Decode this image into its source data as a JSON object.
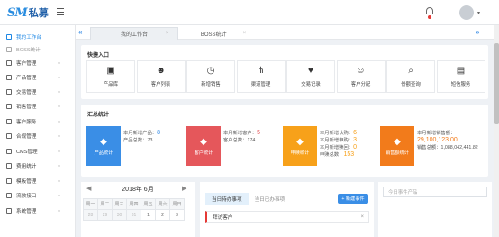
{
  "brand": {
    "mark": "SM",
    "name": "私募"
  },
  "sidebar": {
    "items": [
      {
        "label": "我的工作台",
        "active": true
      },
      {
        "label": "BOSS统计",
        "sub": true
      },
      {
        "label": "客户管理"
      },
      {
        "label": "产品管理"
      },
      {
        "label": "交易管理"
      },
      {
        "label": "销售管理"
      },
      {
        "label": "客户服务"
      },
      {
        "label": "合规管理"
      },
      {
        "label": "CMS管理"
      },
      {
        "label": "费用统计"
      },
      {
        "label": "模板管理"
      },
      {
        "label": "流数接口"
      },
      {
        "label": "系统管理"
      }
    ]
  },
  "tabs": {
    "left_arrow": "«",
    "right_arrow": "»",
    "items": [
      {
        "label": "我的工作台",
        "close": "×"
      },
      {
        "label": "BOSS统计",
        "close": "×"
      }
    ]
  },
  "quick": {
    "title": "快捷入口",
    "items": [
      {
        "label": "产品库",
        "icon": "box-icon"
      },
      {
        "label": "客户列表",
        "icon": "users-icon"
      },
      {
        "label": "新增销售",
        "icon": "clock-icon"
      },
      {
        "label": "渠道管理",
        "icon": "share-icon"
      },
      {
        "label": "交易记录",
        "icon": "handshake-icon"
      },
      {
        "label": "客户分配",
        "icon": "user-assign-icon"
      },
      {
        "label": "份额查询",
        "icon": "search-icon"
      },
      {
        "label": "短信服务",
        "icon": "clipboard-icon"
      }
    ]
  },
  "stats": {
    "title": "汇总统计",
    "cards": [
      {
        "box_label": "产品统计",
        "color": "#3a8ee6",
        "lines": [
          {
            "label": "本月新增产品：",
            "value": "8"
          },
          {
            "label": "产品总数：",
            "value": "73"
          }
        ]
      },
      {
        "box_label": "客户统计",
        "color": "#e5575b",
        "lines": [
          {
            "label": "本月新增客户：",
            "value": "5"
          },
          {
            "label": "客户总数：",
            "value": "174"
          }
        ]
      },
      {
        "box_label": "申赎统计",
        "color": "#f7a11a",
        "lines": [
          {
            "label": "本月新增认购：",
            "value": "6"
          },
          {
            "label": "本月新增申购：",
            "value": "3"
          },
          {
            "label": "本月新增赎回：",
            "value": "0"
          },
          {
            "label": "申赎总数：",
            "value": "153"
          }
        ]
      },
      {
        "box_label": "销售额统计",
        "color": "#f27b1b",
        "lines": [
          {
            "label": "本月新增销售额：",
            "value": ""
          },
          {
            "label": "",
            "value": "29,100,123.00"
          },
          {
            "label": "销售总额：",
            "value": "1,088,042,441.82"
          }
        ]
      }
    ]
  },
  "calendar": {
    "title": "2018年 6月",
    "prev": "◀",
    "next": "▶",
    "weekdays": [
      "周一",
      "周二",
      "周三",
      "周四",
      "周五",
      "周六",
      "周日"
    ],
    "days": [
      "28",
      "29",
      "30",
      "31",
      "1",
      "2",
      "3"
    ]
  },
  "todo": {
    "tabs": [
      "当日待办事项",
      "当日已办事项"
    ],
    "button": "+ 新建事件",
    "items": [
      {
        "label": "拜访客户",
        "close": "×"
      }
    ]
  },
  "search": {
    "placeholder": "今日事件产品"
  }
}
